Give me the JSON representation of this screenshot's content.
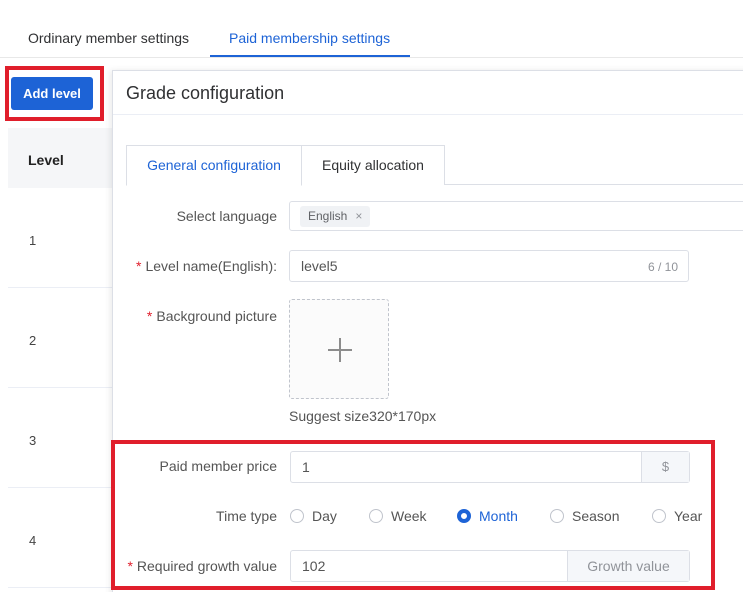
{
  "tabs": {
    "ordinary": "Ordinary member settings",
    "paid": "Paid membership settings"
  },
  "add_level_label": "Add level",
  "level_table": {
    "header": "Level",
    "rows": [
      "1",
      "2",
      "3",
      "4"
    ]
  },
  "dialog": {
    "title": "Grade configuration",
    "tabs": {
      "general": "General configuration",
      "equity": "Equity allocation"
    },
    "select_language": {
      "label": "Select language",
      "tag": "English",
      "tag_close": "×"
    },
    "level_name": {
      "required_mark": "*",
      "label": "Level name(English):",
      "value": "level5",
      "counter": "6 / 10"
    },
    "background_picture": {
      "required_mark": "*",
      "label": "Background picture",
      "suggest": "Suggest size320*170px"
    },
    "paid_member_price": {
      "label": "Paid member price",
      "value": "1",
      "suffix": "$"
    },
    "time_type": {
      "label": "Time type",
      "options": [
        "Day",
        "Week",
        "Month",
        "Season",
        "Year"
      ],
      "selected": "Month"
    },
    "growth_value": {
      "required_mark": "*",
      "label": "Required growth value",
      "value": "102",
      "suffix": "Growth value"
    }
  },
  "colors": {
    "accent": "#1d63d6",
    "highlight_border": "#e01e2b"
  }
}
